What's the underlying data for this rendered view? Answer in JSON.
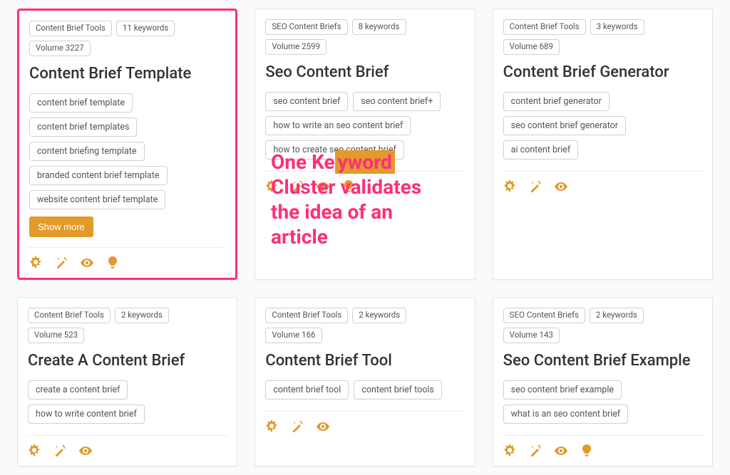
{
  "annotation": {
    "line1_a": "One Ke",
    "line1_b": "yword",
    "line2": "Cluster validates",
    "line3": " the idea of an",
    "line4": "article"
  },
  "cards": [
    {
      "highlighted": true,
      "meta": {
        "category": "Content Brief Tools",
        "keywords": "11 keywords",
        "volume": "Volume 3227"
      },
      "title": "Content Brief Template",
      "kw_rows": [
        [
          "content brief template"
        ],
        [
          "content brief templates"
        ],
        [
          "content briefing template"
        ],
        [
          "branded content brief template"
        ],
        [
          "website content brief template"
        ]
      ],
      "show_more": "Show more",
      "icons": [
        "gear",
        "wand",
        "eye",
        "bulb"
      ]
    },
    {
      "highlighted": false,
      "meta": {
        "category": "SEO Content Briefs",
        "keywords": "8 keywords",
        "volume": "Volume 2599"
      },
      "title": "Seo Content Brief",
      "kw_rows": [
        [
          "seo content brief",
          "seo content brief+"
        ],
        [
          "how to write an seo content brief"
        ],
        [
          "how to create seo content brief"
        ]
      ],
      "show_more": null,
      "icons": [
        "gear",
        "wand",
        "eye",
        "bulb"
      ]
    },
    {
      "highlighted": false,
      "meta": {
        "category": "Content Brief Tools",
        "keywords": "3 keywords",
        "volume": "Volume 689"
      },
      "title": "Content Brief Generator",
      "kw_rows": [
        [
          "content brief generator"
        ],
        [
          "seo content brief generator"
        ],
        [
          "ai content brief"
        ]
      ],
      "show_more": null,
      "icons": [
        "gear",
        "wand",
        "eye"
      ]
    },
    {
      "highlighted": false,
      "meta": {
        "category": "Content Brief Tools",
        "keywords": "2 keywords",
        "volume": "Volume 523"
      },
      "title": "Create A Content Brief",
      "kw_rows": [
        [
          "create a content brief"
        ],
        [
          "how to write content brief"
        ]
      ],
      "show_more": null,
      "icons": [
        "gear",
        "wand",
        "eye"
      ]
    },
    {
      "highlighted": false,
      "meta": {
        "category": "Content Brief Tools",
        "keywords": "2 keywords",
        "volume": "Volume 166"
      },
      "title": "Content Brief Tool",
      "kw_rows": [
        [
          "content brief tool",
          "content brief tools"
        ]
      ],
      "show_more": null,
      "icons": [
        "gear",
        "wand",
        "eye"
      ]
    },
    {
      "highlighted": false,
      "meta": {
        "category": "SEO Content Briefs",
        "keywords": "2 keywords",
        "volume": "Volume 143"
      },
      "title": "Seo Content Brief Example",
      "kw_rows": [
        [
          "seo content brief example"
        ],
        [
          "what is an seo content brief"
        ]
      ],
      "show_more": null,
      "icons": [
        "gear",
        "wand",
        "eye",
        "bulb"
      ]
    }
  ]
}
